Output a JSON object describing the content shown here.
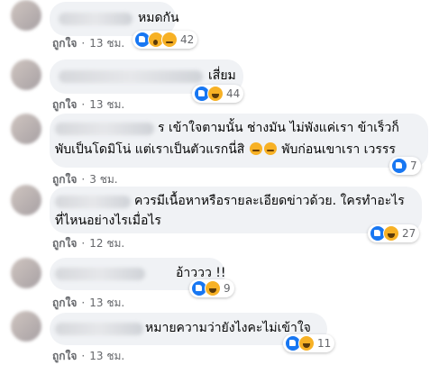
{
  "comments": [
    {
      "text": "หมดกัน",
      "like_label": "ถูกใจ",
      "time": "13 ชม.",
      "reaction_count": "42"
    },
    {
      "text": "เสี่ยม",
      "like_label": "ถูกใจ",
      "time": "13 ชม.",
      "reaction_count": "44"
    },
    {
      "line1": "ร เข้าใจตามนั้น ช่างมัน ไม่พังแค่เรา ข้าเร็วก็",
      "line2_a": "พับเป็นโดมิโน่ แต่เราเป็นตัวแรกนี่สิ",
      "line2_b": "พับก่อนเขาเรา เวรรร",
      "like_label": "ถูกใจ",
      "time": "3 ชม.",
      "reaction_count": "7"
    },
    {
      "line1": "ควรมีเนื้อหาหรือรายละเอียดข่าวด้วย. ใครทำอะไร",
      "line2": "ที่ไหนอย่างไรเมื่อไร",
      "like_label": "ถูกใจ",
      "time": "12 ชม.",
      "reaction_count": "27"
    },
    {
      "text": "อ้าววว !!",
      "like_label": "ถูกใจ",
      "time": "13 ชม.",
      "reaction_count": "9"
    },
    {
      "text": "หมายความว่ายังไงคะไม่เข้าใจ",
      "like_label": "ถูกใจ",
      "time": "13 ชม.",
      "reaction_count": "11"
    }
  ],
  "colors": {
    "bubble": "#f0f2f5",
    "meta_text": "#65676b",
    "like_blue": "#1877f2",
    "emoji_yellow": "#f7b125"
  }
}
